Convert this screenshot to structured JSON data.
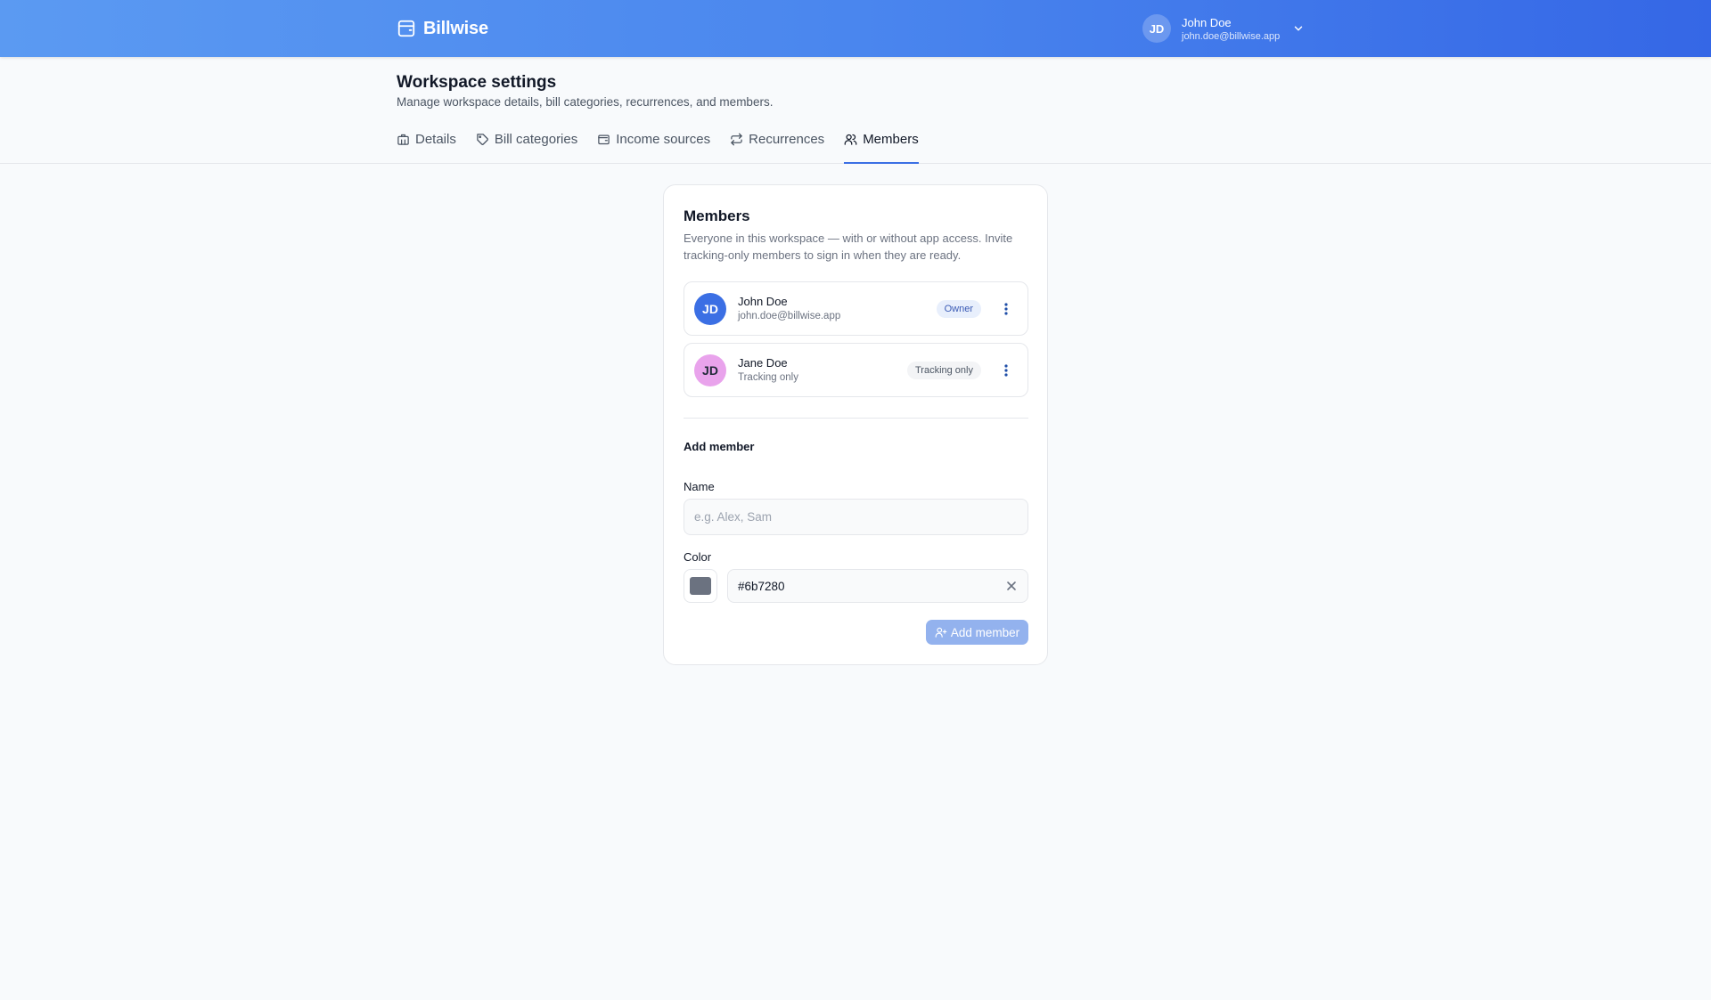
{
  "header": {
    "brand": "Billwise",
    "user": {
      "initials": "JD",
      "name": "John Doe",
      "email": "john.doe@billwise.app"
    }
  },
  "page": {
    "title": "Workspace settings",
    "subtitle": "Manage workspace details, bill categories, recurrences, and members."
  },
  "tabs": [
    {
      "label": "Details",
      "icon": "building-icon"
    },
    {
      "label": "Bill categories",
      "icon": "tag-icon"
    },
    {
      "label": "Income sources",
      "icon": "wallet-icon"
    },
    {
      "label": "Recurrences",
      "icon": "repeat-icon"
    },
    {
      "label": "Members",
      "icon": "users-icon",
      "active": true
    }
  ],
  "members_card": {
    "title": "Members",
    "description": "Everyone in this workspace — with or without app access. Invite tracking-only members to sign in when they are ready.",
    "members": [
      {
        "initials": "JD",
        "name": "John Doe",
        "subtitle": "john.doe@billwise.app",
        "badge": "Owner",
        "avatar_color": "#3b6fe4"
      },
      {
        "initials": "JD",
        "name": "Jane Doe",
        "subtitle": "Tracking only",
        "badge": "Tracking only",
        "avatar_color": "#e9a3ec"
      }
    ],
    "add_member": {
      "section_title": "Add member",
      "name_label": "Name",
      "name_placeholder": "e.g. Alex, Sam",
      "color_label": "Color",
      "color_value": "#6b7280",
      "submit_label": "Add member"
    }
  },
  "colors": {
    "accent": "#3b6fe4",
    "owner_badge_bg": "#e8effc",
    "owner_badge_text": "#3b5bb5",
    "neutral_badge_bg": "#f3f4f6",
    "neutral_badge_text": "#4b5563"
  }
}
